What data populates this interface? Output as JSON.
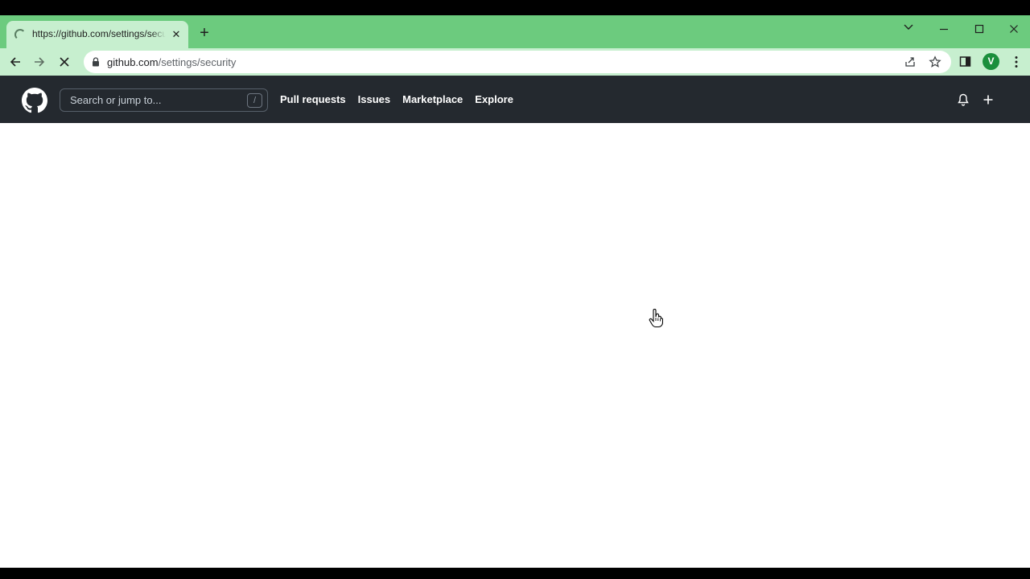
{
  "browser": {
    "tab": {
      "title": "https://github.com/settings/security",
      "close_glyph": "✕"
    },
    "new_tab_glyph": "+",
    "address": {
      "host": "github.com",
      "path": "/settings/security"
    },
    "profile_initial": "V",
    "theme_color": "#6ccb7e",
    "toolbar_color": "#c7efcf"
  },
  "github": {
    "search_placeholder": "Search or jump to...",
    "search_shortcut": "/",
    "nav": [
      "Pull requests",
      "Issues",
      "Marketplace",
      "Explore"
    ],
    "header_color": "#24292f"
  },
  "icons": {
    "tab": "loading-spinner-icon",
    "nav": [
      "back-arrow-icon",
      "forward-arrow-icon",
      "stop-loading-icon"
    ],
    "omnibox": [
      "lock-icon",
      "share-icon",
      "star-icon"
    ],
    "toolbar": [
      "side-panel-icon",
      "kebab-menu-icon"
    ],
    "window": [
      "tab-search-chevron-icon",
      "minimize-icon",
      "maximize-icon",
      "close-icon"
    ],
    "github": [
      "github-octocat-icon",
      "bell-icon",
      "plus-icon"
    ]
  }
}
